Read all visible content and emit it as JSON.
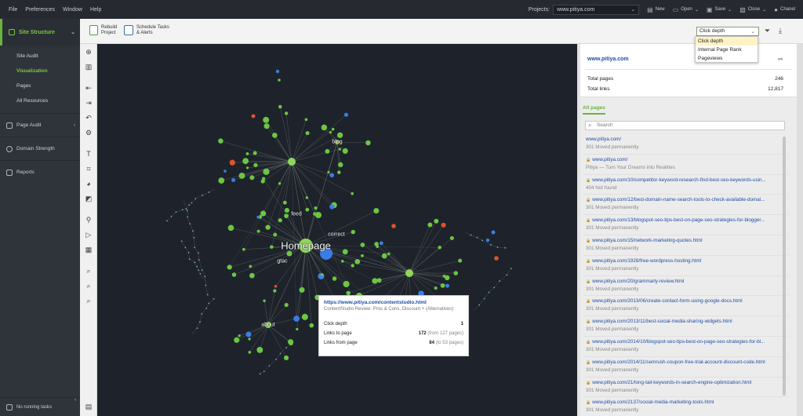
{
  "menu": [
    "File",
    "Preferences",
    "Window",
    "Help"
  ],
  "projects": {
    "label": "Projects:",
    "value": "www.pitiya.com"
  },
  "top_actions": [
    {
      "name": "new",
      "label": "New"
    },
    {
      "name": "open",
      "label": "Open"
    },
    {
      "name": "save",
      "label": "Save"
    },
    {
      "name": "close",
      "label": "Close"
    },
    {
      "name": "user",
      "label": "Chanel"
    }
  ],
  "sidebar": {
    "module": "Site Structure",
    "items": [
      {
        "label": "Site Audit",
        "active": false
      },
      {
        "label": "Visualization",
        "active": true
      },
      {
        "label": "Pages",
        "active": false
      },
      {
        "label": "All Resources",
        "active": false
      }
    ],
    "sections": [
      {
        "label": "Page Audit",
        "arrow": true
      },
      {
        "label": "Domain Strength",
        "arrow": false
      },
      {
        "label": "Reports",
        "arrow": false
      }
    ],
    "running": "No running tasks"
  },
  "toolbar": {
    "rebuild_l1": "Rebuild",
    "rebuild_l2": "Project",
    "schedule_l1": "Schedule Tasks",
    "schedule_l2": "& Alerts",
    "metric_value": "Click depth",
    "metric_options": [
      "Click depth",
      "Internal Page Rank",
      "Pageviews"
    ]
  },
  "graph": {
    "labels": {
      "home": "Homepage",
      "blog": "blog",
      "feed": "feed",
      "correct": "correct",
      "gtac": "gtac",
      "about": "about"
    },
    "colors": {
      "node": "#6cc644",
      "hub": "#8fd65a",
      "blue": "#3b7de8",
      "red": "#e2522d",
      "edge": "#8a9a8a",
      "background": "#1e232b"
    }
  },
  "tooltip": {
    "url": "https://www.pitiya.com/contentstudio.html",
    "title": "ContentStudio Review: Pros & Cons, Discount + (Alternatives)",
    "click_depth_label": "Click depth",
    "click_depth": "1",
    "links_to_label": "Links to page",
    "links_to": "172",
    "links_to_note": "(from 127 pages)",
    "links_from_label": "Links from page",
    "links_from": "84",
    "links_from_note": "(to 53 pages)"
  },
  "panel": {
    "domain": "www.pitiya.com",
    "total_pages_label": "Total pages",
    "total_pages": "246",
    "total_links_label": "Total links",
    "total_links": "12,817",
    "all_pages_tab": "All pages",
    "search_placeholder": "Search",
    "pages": [
      {
        "url": "www.pitiya.com/",
        "status": "301 Moved permanently",
        "lock": false
      },
      {
        "url": "www.pitiya.com/",
        "status": "Pitiya — Turn Your Dreams into Realities",
        "lock": true
      },
      {
        "url": "www.pitiya.com/10/competitor-keyword-research-find-best-seo-keywords-usin...",
        "status": "404 Not found",
        "lock": true
      },
      {
        "url": "www.pitiya.com/12/best-domain-name-search-tools-to-check-available-domai...",
        "status": "301 Moved permanently",
        "lock": true
      },
      {
        "url": "www.pitiya.com/13/blogspot-seo-tips-best-on-page-seo-strategies-for-blogger...",
        "status": "301 Moved permanently",
        "lock": true
      },
      {
        "url": "www.pitiya.com/15/network-marketing-quotes.html",
        "status": "301 Moved permanently",
        "lock": true
      },
      {
        "url": "www.pitiya.com/1928/free-wordpress-hosting.html",
        "status": "301 Moved permanently",
        "lock": true
      },
      {
        "url": "www.pitiya.com/20/grammarly-review.html",
        "status": "301 Moved permanently",
        "lock": true
      },
      {
        "url": "www.pitiya.com/2013/06/create-contact-form-using-google-docs.html",
        "status": "301 Moved permanently",
        "lock": true
      },
      {
        "url": "www.pitiya.com/2013/11/best-social-media-sharing-widgets.html",
        "status": "301 Moved permanently",
        "lock": true
      },
      {
        "url": "www.pitiya.com/2014/10/blogspot-seo-tips-best-on-page-seo-strategies-for-bl...",
        "status": "301 Moved permanently",
        "lock": true
      },
      {
        "url": "www.pitiya.com/2014/11/semrush-coupon-free-trial-account-discount-code.html",
        "status": "301 Moved permanently",
        "lock": true
      },
      {
        "url": "www.pitiya.com/21/long-tail-keywords-in-search-engine-optimization.html",
        "status": "301 Moved permanently",
        "lock": true
      },
      {
        "url": "www.pitiya.com/2137/social-media-marketing-tools.html",
        "status": "301 Moved permanently",
        "lock": true
      }
    ]
  }
}
